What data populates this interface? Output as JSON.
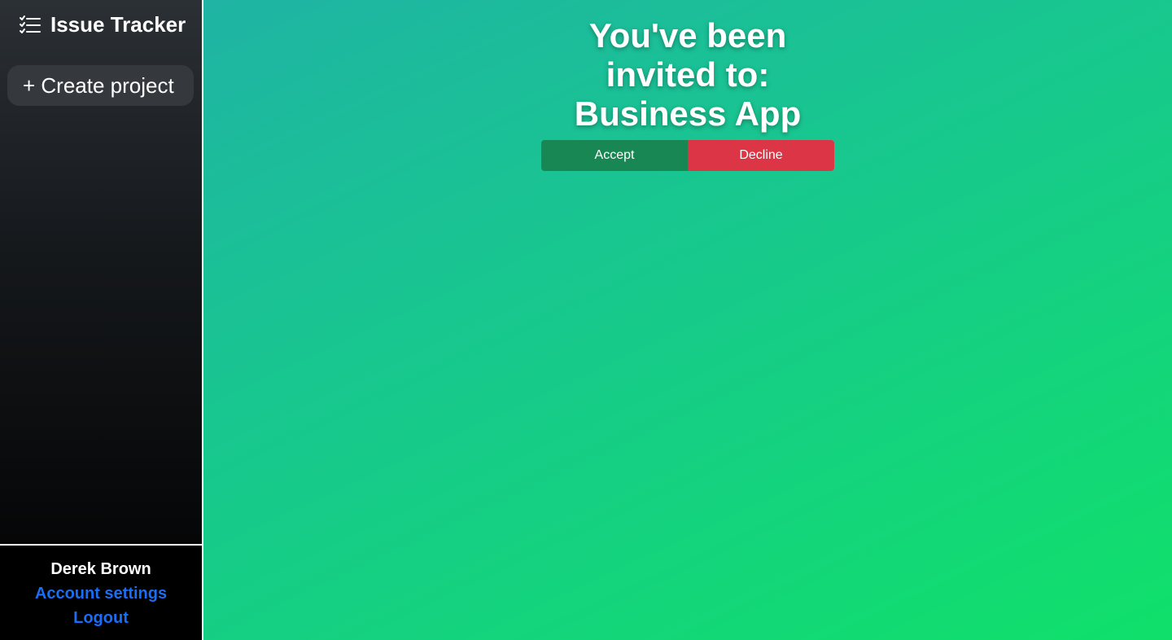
{
  "app": {
    "title": "Issue Tracker",
    "logo_icon": "checklist-icon"
  },
  "sidebar": {
    "create_project_label": "+ Create project"
  },
  "user": {
    "name": "Derek Brown",
    "account_settings_label": "Account settings",
    "logout_label": "Logout",
    "link_color": "#1a6ef5"
  },
  "invite": {
    "line1": "You've been",
    "line2": "invited to:",
    "project_name": "Business App",
    "accept_label": "Accept",
    "decline_label": "Decline"
  },
  "colors": {
    "accept": "#198754",
    "decline": "#dc3545",
    "gradient_start": "#1fb4a4",
    "gradient_end": "#10e06a"
  }
}
